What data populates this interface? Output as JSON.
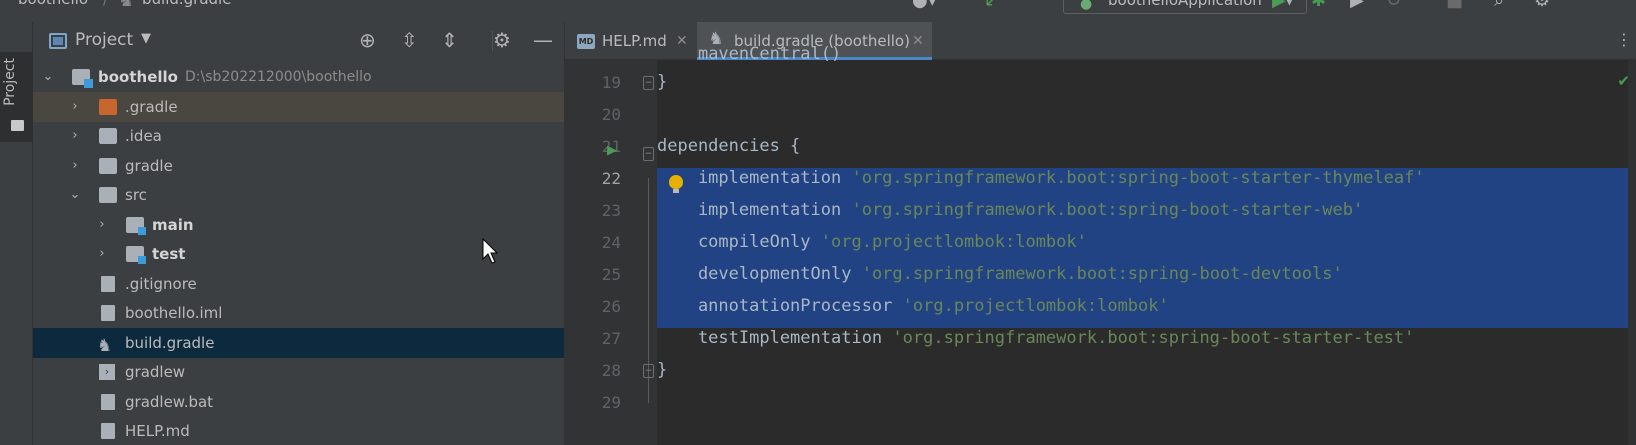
{
  "breadcrumb": {
    "project": "boothello",
    "file": "build.gradle"
  },
  "toolbar": {
    "run_config": "boothelloApplication"
  },
  "tool_strip": {
    "project_label": "Project"
  },
  "project_panel": {
    "title": "Project",
    "tree": [
      {
        "id": "root",
        "name": "boothello",
        "path": "D:\\sb202212000\\boothello",
        "expanded": true
      },
      {
        "id": "gradle-hidden",
        "name": ".gradle"
      },
      {
        "id": "idea",
        "name": ".idea"
      },
      {
        "id": "gradle",
        "name": "gradle"
      },
      {
        "id": "src",
        "name": "src",
        "expanded": true
      },
      {
        "id": "main",
        "name": "main"
      },
      {
        "id": "test",
        "name": "test"
      },
      {
        "id": "gitignore",
        "name": ".gitignore"
      },
      {
        "id": "iml",
        "name": "boothello.iml"
      },
      {
        "id": "build-gradle",
        "name": "build.gradle",
        "selected": true
      },
      {
        "id": "gradlew",
        "name": "gradlew"
      },
      {
        "id": "gradlew-bat",
        "name": "gradlew.bat"
      },
      {
        "id": "help",
        "name": "HELP.md"
      }
    ]
  },
  "editor": {
    "tabs": [
      {
        "icon": "MD",
        "label": "HELP.md",
        "active": false
      },
      {
        "icon": "gradle",
        "label": "build.gradle (boothello)",
        "active": true
      }
    ],
    "cropped_top_line": "mavenCentral()",
    "lines": [
      {
        "num": "19",
        "code": "}",
        "str": ""
      },
      {
        "num": "20",
        "code": "",
        "str": ""
      },
      {
        "num": "21",
        "code": "dependencies {",
        "str": ""
      },
      {
        "num": "22",
        "code": "    implementation ",
        "str": "'org.springframework.boot:spring-boot-starter-thymeleaf'"
      },
      {
        "num": "23",
        "code": "    implementation ",
        "str": "'org.springframework.boot:spring-boot-starter-web'"
      },
      {
        "num": "24",
        "code": "    compileOnly ",
        "str": "'org.projectlombok:lombok'"
      },
      {
        "num": "25",
        "code": "    developmentOnly ",
        "str": "'org.springframework.boot:spring-boot-devtools'"
      },
      {
        "num": "26",
        "code": "    annotationProcessor ",
        "str": "'org.projectlombok:lombok'"
      },
      {
        "num": "27",
        "code": "    testImplementation ",
        "str": "'org.springframework.boot:spring-boot-starter-test'"
      },
      {
        "num": "28",
        "code": "}",
        "str": ""
      },
      {
        "num": "29",
        "code": "",
        "str": ""
      }
    ]
  },
  "colors": {
    "selection": "#214283",
    "string": "#6a8759",
    "keyword_text": "#a9b7c6",
    "tree_selection": "#0d293e",
    "accent_tab": "#4a88c7"
  }
}
